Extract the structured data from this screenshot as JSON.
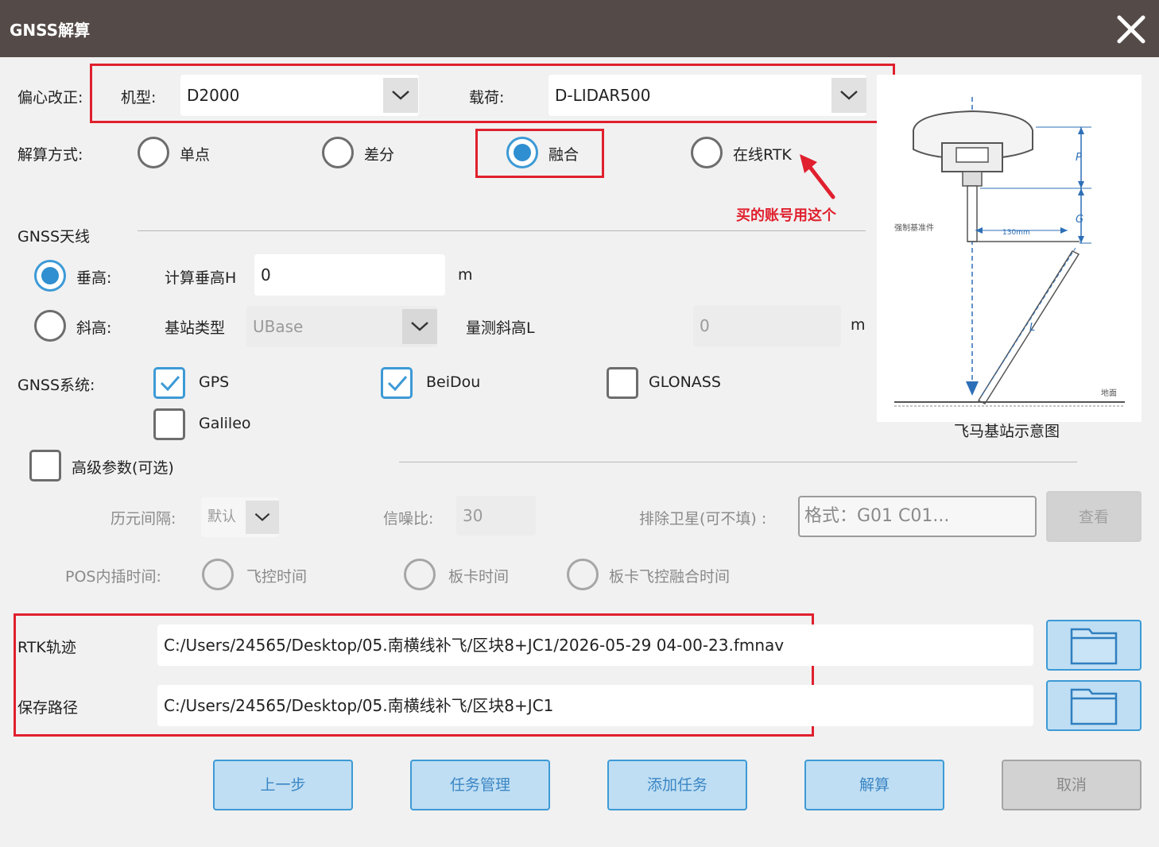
{
  "window": {
    "title": "GNSS解算"
  },
  "eccentric": {
    "label": "偏心改正:",
    "model_label": "机型:",
    "model_value": "D2000",
    "payload_label": "载荷:",
    "payload_value": "D-LIDAR500"
  },
  "solve_method": {
    "label": "解算方式:",
    "options": [
      "单点",
      "差分",
      "融合",
      "在线RTK"
    ],
    "selected": "融合"
  },
  "annotation": {
    "text": "买的账号用这个",
    "color": "#e0202e"
  },
  "antenna": {
    "section_title": "GNSS天线",
    "vertical_label": "垂高:",
    "calc_label": "计算垂高H",
    "calc_value": "0",
    "unit1": "m",
    "slant_label": "斜高:",
    "base_type_label": "基站类型",
    "base_type_value": "UBase",
    "measure_label": "量测斜高L",
    "measure_value": "0",
    "unit2": "m",
    "selected": "垂高"
  },
  "diagram": {
    "caption": "飞马基站示意图",
    "label_p": "P",
    "label_g": "G",
    "label_l": "L",
    "label_rod": "强制基准件",
    "label_width": "130mm",
    "label_ground": "地面"
  },
  "systems": {
    "label": "GNSS系统:",
    "items": [
      {
        "name": "GPS",
        "checked": true
      },
      {
        "name": "BeiDou",
        "checked": true
      },
      {
        "name": "GLONASS",
        "checked": false
      },
      {
        "name": "Galileo",
        "checked": false
      }
    ]
  },
  "advanced": {
    "label": "高级参数(可选)",
    "checked": false,
    "epoch_label": "历元间隔:",
    "epoch_value": "默认",
    "snr_label": "信噪比:",
    "snr_value": "30",
    "exclude_label": "排除卫星(可不填) :",
    "exclude_placeholder": "格式：G01 C01...",
    "view_button": "查看",
    "pos_label": "POS内插时间:",
    "pos_options": [
      "飞控时间",
      "板卡时间",
      "板卡飞控融合时间"
    ]
  },
  "paths": {
    "rtk_label": "RTK轨迹",
    "rtk_value": "C:/Users/24565/Desktop/05.南横线补飞/区块8+JC1/2026-05-29 04-00-23.fmnav",
    "save_label": "保存路径",
    "save_value": "C:/Users/24565/Desktop/05.南横线补飞/区块8+JC1"
  },
  "buttons": {
    "prev": "上一步",
    "task_manage": "任务管理",
    "add_task": "添加任务",
    "solve": "解算",
    "cancel": "取消"
  },
  "colors": {
    "titlebar": "#544b48",
    "accent": "#3d9ad6",
    "highlight_red": "#e0202e",
    "button_fill": "#bfdef3"
  }
}
